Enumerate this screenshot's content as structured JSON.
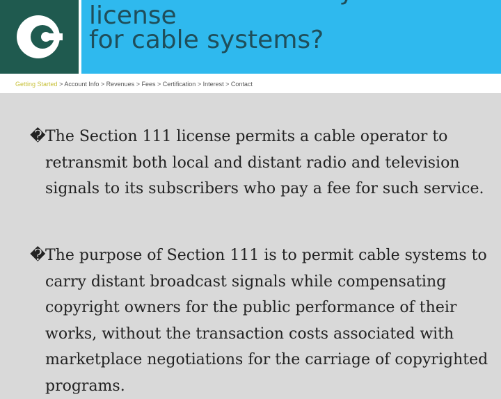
{
  "header": {
    "title": "What is the statutory\nlicense\nfor cable systems?",
    "logo_icon": "c-logo-icon",
    "colors": {
      "logo_bg": "#1f5a4f",
      "title_bg": "#2fb9ee",
      "title_text": "#1f4e5a"
    }
  },
  "breadcrumb": {
    "items": [
      "Getting Started",
      "Account Info",
      "Revenues",
      "Fees",
      "Certification",
      "Interest",
      "Contact"
    ],
    "separator": ">"
  },
  "body": {
    "bullet": "�",
    "paragraphs": [
      "The Section 111 license permits a cable operator to retransmit both local and distant radio and television signals to its subscribers who pay a fee for such service.",
      "The purpose of Section 111 is to permit cable systems to carry distant broadcast signals while compensating copyright owners for the public performance of their works, without the transaction costs associated with marketplace negotiations for the carriage of copyrighted programs."
    ]
  }
}
